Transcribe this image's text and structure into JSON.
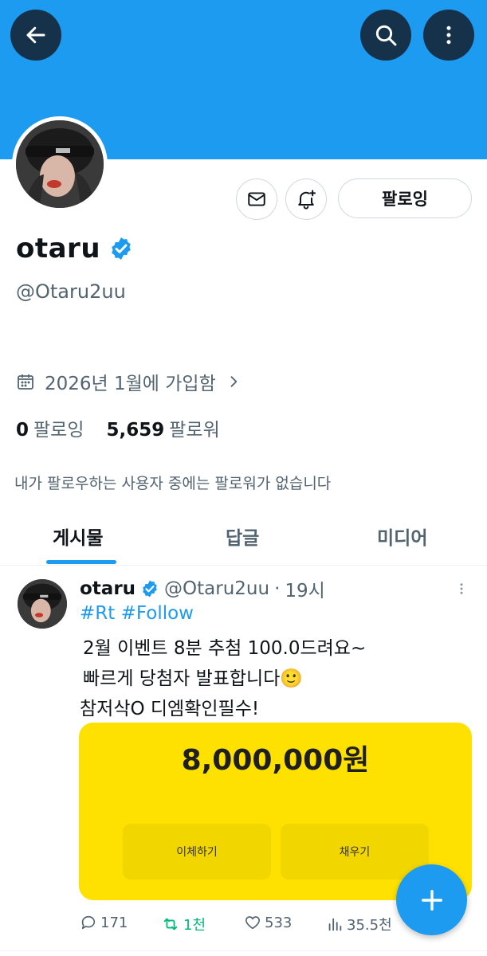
{
  "header": {
    "back_icon": "arrow-left-icon",
    "search_icon": "search-icon",
    "more_icon": "more-vertical-icon",
    "banner_color": "#1d9bf0"
  },
  "profile": {
    "display_name": "otaru",
    "verified": true,
    "handle": "@Otaru2uu",
    "joined": "2026년 1월에 가입함",
    "following_count": "0",
    "following_label": "팔로잉",
    "followers_count": "5,659",
    "followers_label": "팔로워",
    "followers_note": "내가 팔로우하는 사용자 중에는 팔로워가 없습니다",
    "follow_button_label": "팔로잉"
  },
  "tabs": [
    {
      "label": "게시물",
      "active": true
    },
    {
      "label": "답글",
      "active": false
    },
    {
      "label": "미디어",
      "active": false
    }
  ],
  "tweet": {
    "name": "otaru",
    "handle": "@Otaru2uu",
    "time": "19시",
    "hashtags": "#Rt #Follow",
    "lines": [
      "2월 이벤트 8분 추첨 100.0드려요~",
      "빠르게 당첨자 발표합니다🙂",
      "참저삭O 디엠확인필수!"
    ],
    "card": {
      "amount": "8,000,000원",
      "transfer_label": "이체하기",
      "charge_label": "채우기",
      "color": "#ffe100"
    },
    "actions": {
      "replies": "171",
      "retweets": "1천",
      "likes": "533",
      "views": "35.5천"
    }
  },
  "accent_color": "#1d9bf0"
}
